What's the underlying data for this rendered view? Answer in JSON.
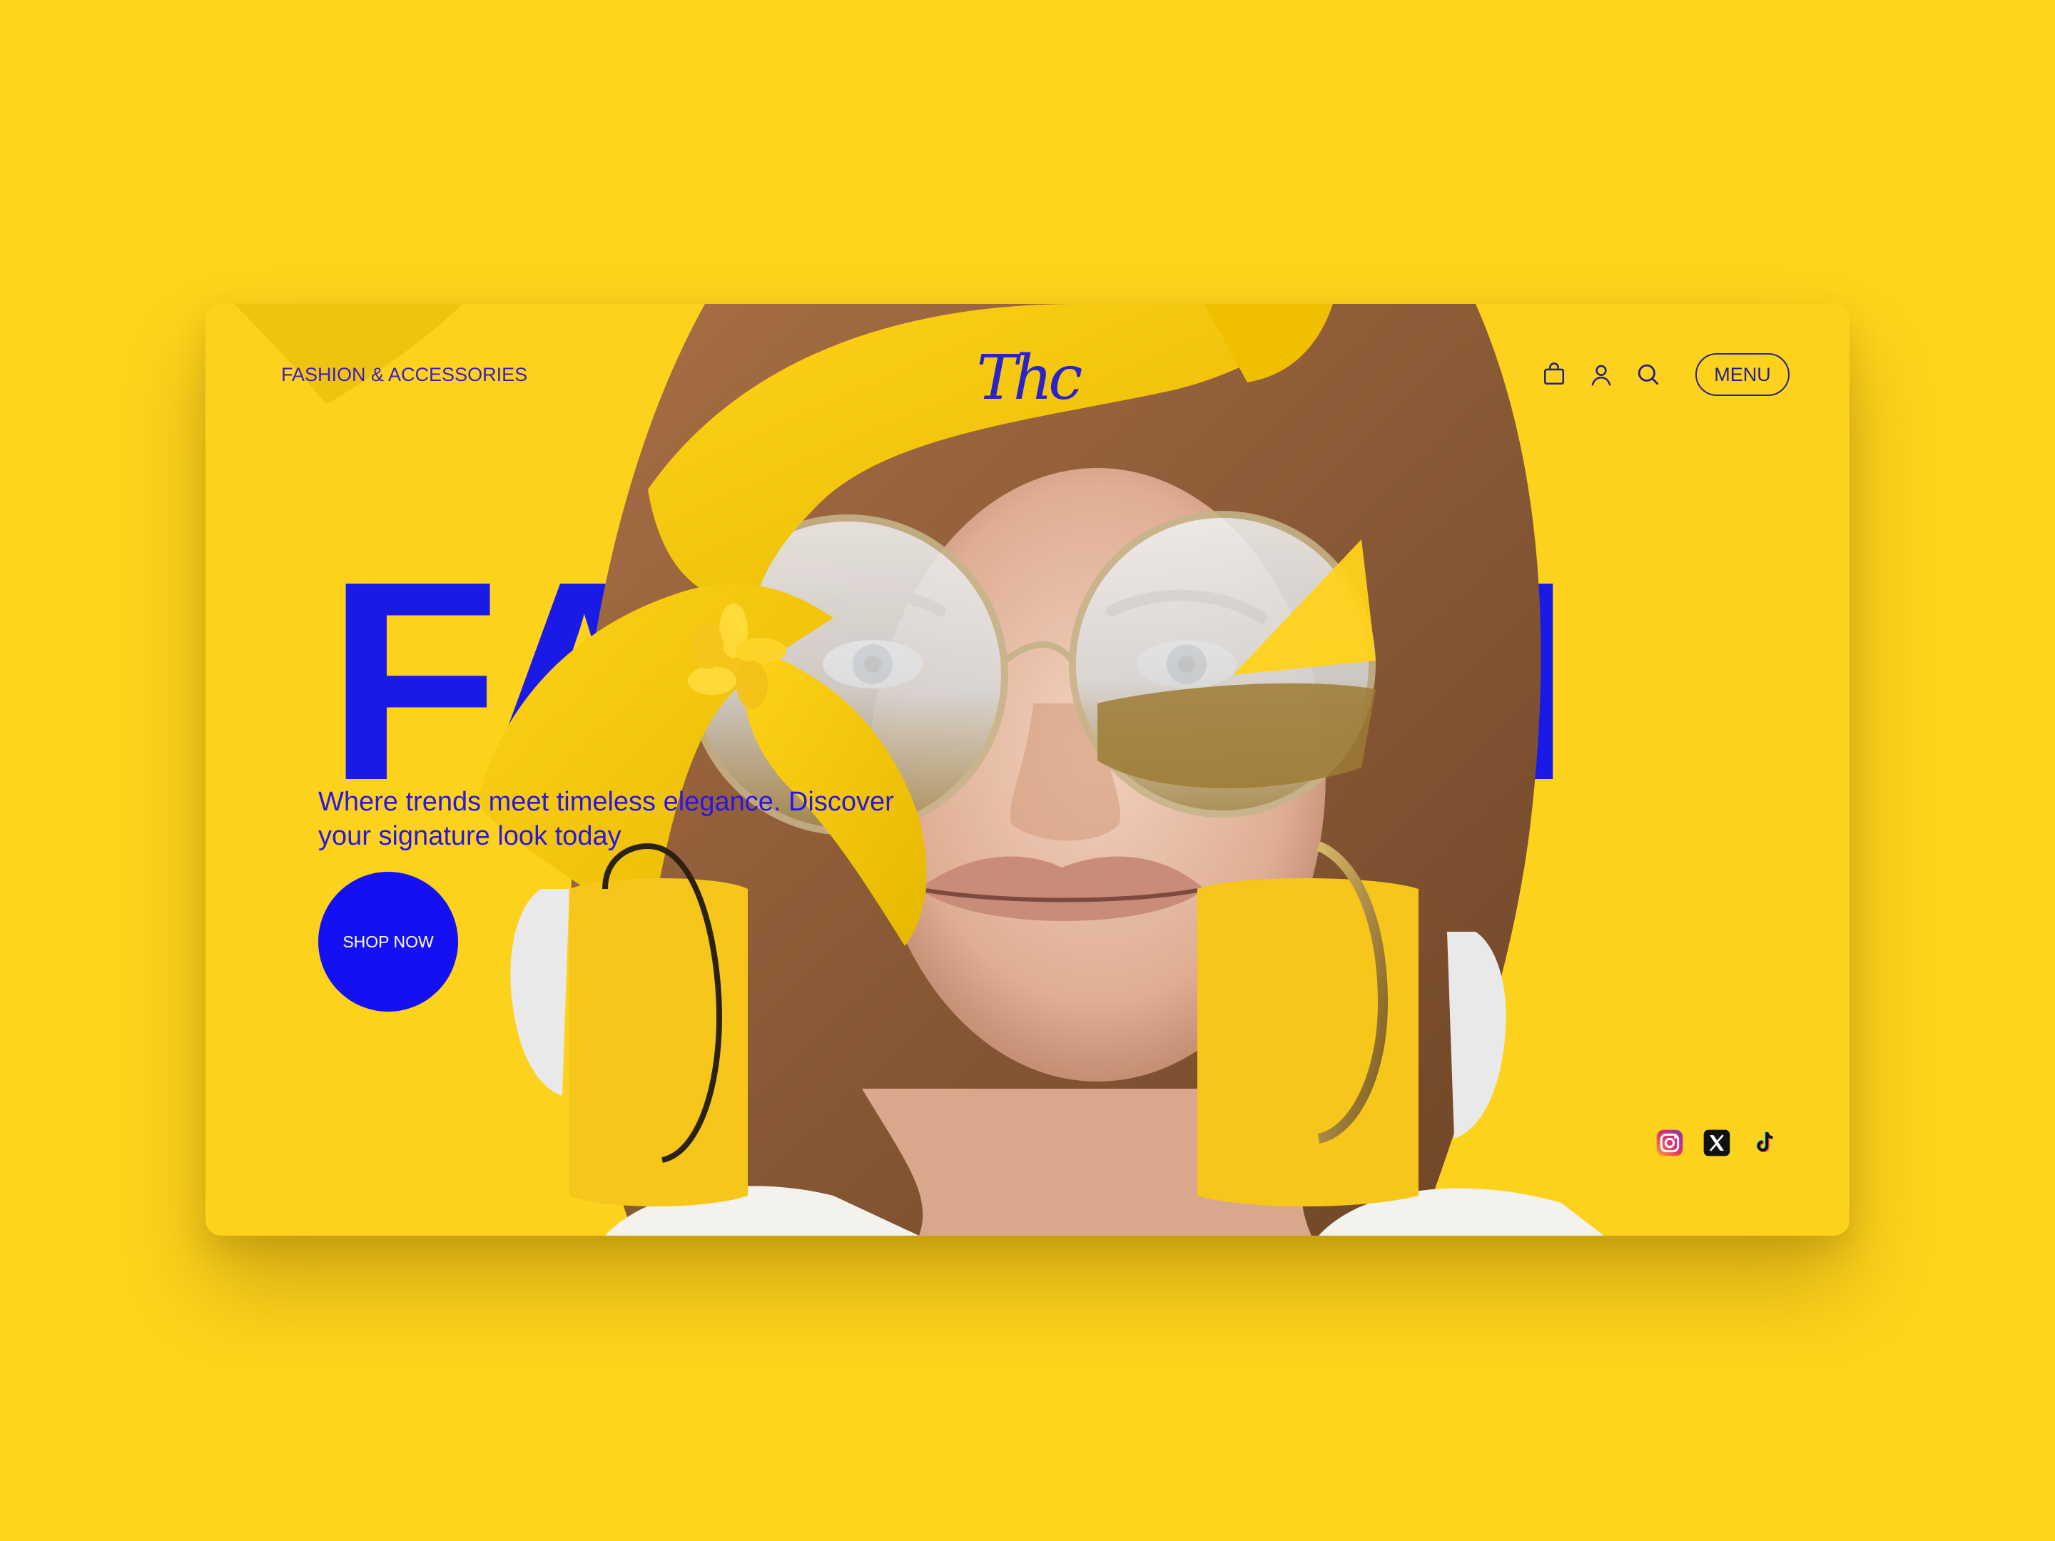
{
  "header": {
    "category_label": "FASHION & ACCESSORIES",
    "logo_text": "Thc",
    "menu_label": "MENU",
    "icons": [
      "shopping-bag-icon",
      "user-icon",
      "search-icon"
    ]
  },
  "hero": {
    "headline": "FASHION",
    "tagline": "Where trends meet timeless elegance. Discover your signature look today",
    "cta_label": "SHOP NOW"
  },
  "social": {
    "icons": [
      "instagram-icon",
      "x-icon",
      "tiktok-icon"
    ]
  },
  "colors": {
    "page_background": "#ffd41c",
    "card_background": "#fdd21c",
    "accent_blue": "#1a1ae6",
    "button_blue": "#1410f2"
  }
}
